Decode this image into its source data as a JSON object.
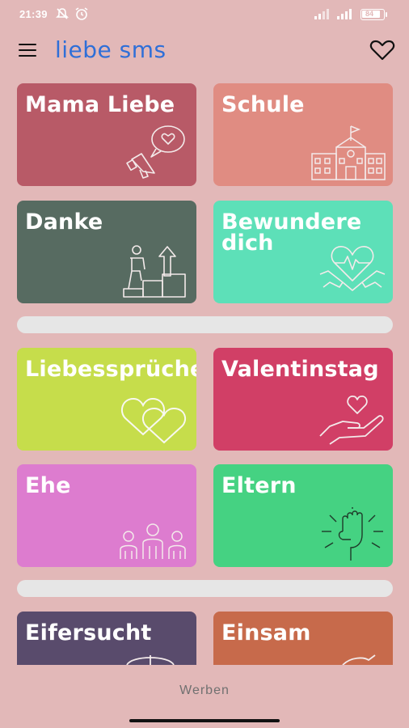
{
  "status": {
    "time": "21:39",
    "battery": "84"
  },
  "header": {
    "title": "liebe sms"
  },
  "cards": [
    {
      "title": "Mama Liebe",
      "color": "#b85a67",
      "icon": "megaphone-heart-icon"
    },
    {
      "title": "Schule",
      "color": "#e08c82",
      "icon": "school-building-icon"
    },
    {
      "title": "Danke",
      "color": "#576b61",
      "icon": "stairs-climb-icon"
    },
    {
      "title": "Bewundere dich",
      "color": "#5de0b8",
      "icon": "heart-hands-icon"
    },
    {
      "title": "Liebessprüche",
      "color": "#c6dd4b",
      "icon": "two-hearts-icon"
    },
    {
      "title": "Valentinstag",
      "color": "#d13f66",
      "icon": "heart-in-hand-icon"
    },
    {
      "title": "Ehe",
      "color": "#dd7ccf",
      "icon": "family-people-icon"
    },
    {
      "title": "Eltern",
      "color": "#45d282",
      "icon": "raised-fist-icon"
    },
    {
      "title": "Eifersucht",
      "color": "#594b6c",
      "icon": "target-icon"
    },
    {
      "title": "Einsam",
      "color": "#c76a4b",
      "icon": "arrow-icon"
    }
  ],
  "footer": {
    "ad_label": "Werben"
  }
}
